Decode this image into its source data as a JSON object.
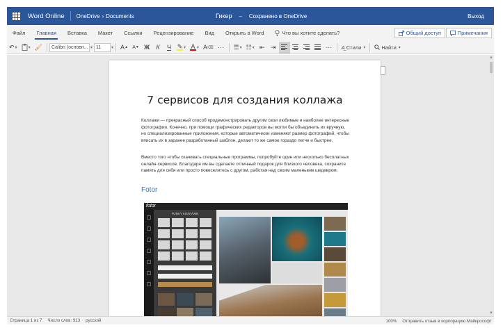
{
  "titlebar": {
    "app_name": "Word Online",
    "breadcrumb_owner": "OneDrive",
    "breadcrumb_sep": "›",
    "breadcrumb_folder": "Documents",
    "doc_name": "Гикер",
    "dash": "–",
    "save_status": "Сохранено в OneDrive",
    "exit_label": "Выход",
    "color": "#2b579a"
  },
  "tabs": [
    "Файл",
    "Главная",
    "Вставка",
    "Макет",
    "Ссылки",
    "Рецензирование",
    "Вид",
    "Открыть в Word"
  ],
  "active_tab": "Главная",
  "tell_me": "Что вы хотите сделать?",
  "share_label": "Общий доступ",
  "comments_label": "Примечания",
  "toolbar": {
    "font_name": "Calibri (основн...",
    "font_size": "11",
    "grow_font": "A",
    "shrink_font": "A",
    "bold": "Ж",
    "italic": "К",
    "underline": "Ч",
    "highlight_color": "#ffeb3b",
    "font_color": "#e00000",
    "more": "···",
    "styles_label": "Стили",
    "find_label": "Найти"
  },
  "document": {
    "heading": "7 сервисов для создания коллажа",
    "paragraph1": "Коллажи — прекрасный способ продемонстрировать другим свои любимые и наиболее интересные фотографии. Конечно, при помощи графических редакторов вы могли бы объединить их вручную, но специализированные приложения, которые автоматически изменяют размер фотографий, чтобы вписать их в заранее разработанный шаблон, делают то же самое гораздо легче и быстрее.",
    "paragraph2": "Вместо того чтобы скачивать специальные программы, попробуйте один или несколько бесплатных онлайн-сервисов. Благодаря им вы сделаете отличный подарок для близкого человека, сохраните память для себя или просто повеселитесь с другом, работая над своим маленьким шедевром.",
    "section_heading": "Fotor",
    "screenshot_logo": "fotor",
    "screenshot_panel_title": "FUNKY КОЛЛАЖИ"
  },
  "statusbar": {
    "page": "Страница 1 из 7",
    "words": "Число слов: 913",
    "language": "русский",
    "zoom": "100%",
    "feedback": "Отправить отзыв в корпорацию Майкрософт"
  }
}
